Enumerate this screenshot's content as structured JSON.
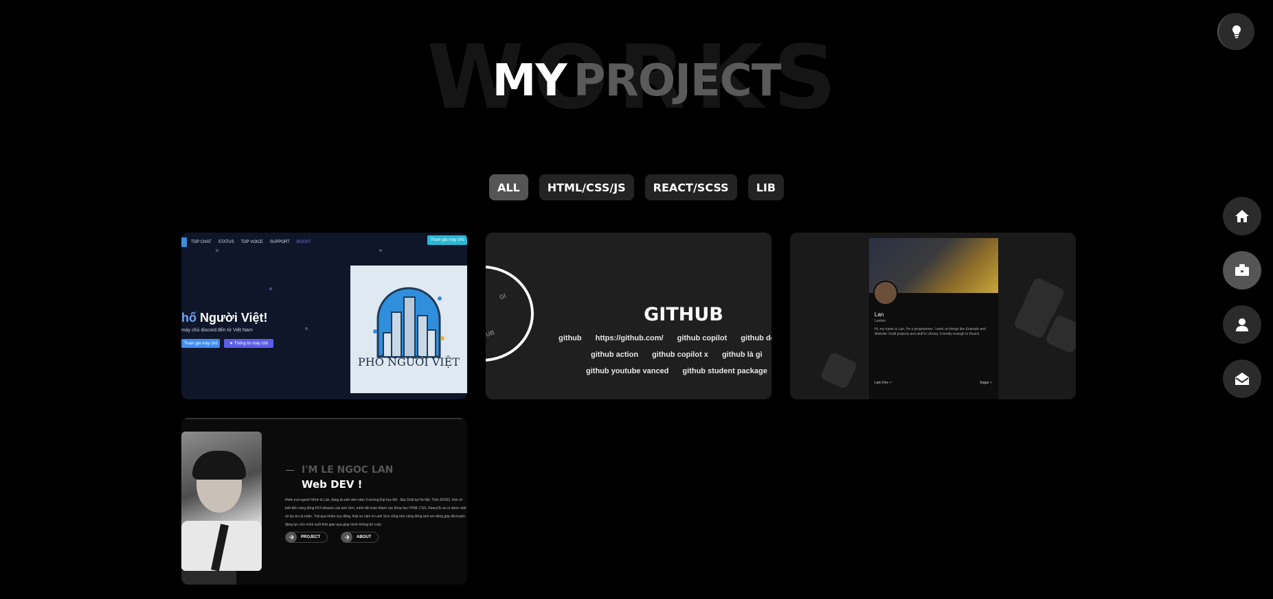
{
  "header": {
    "background_word": "WORKS",
    "title_strong": "MY",
    "title_muted": "PROJECT"
  },
  "theme_toggle": {
    "icon": "lightbulb-icon"
  },
  "filters": [
    {
      "label": "ALL",
      "active": true
    },
    {
      "label": "HTML/CSS/JS",
      "active": false
    },
    {
      "label": "REACT/SCSS",
      "active": false
    },
    {
      "label": "LIB",
      "active": false
    }
  ],
  "side_nav": [
    {
      "icon": "home-icon",
      "active": false
    },
    {
      "icon": "briefcase-icon",
      "active": true
    },
    {
      "icon": "user-icon",
      "active": false
    },
    {
      "icon": "mail-open-icon",
      "active": false
    }
  ],
  "projects": {
    "card1": {
      "nav": [
        "TOP CHAT",
        "STATUS",
        "TOP VOICE",
        "SUPPORT",
        "BOOST"
      ],
      "join_button": "Tham gia máy chủ",
      "heading_a": "hố ",
      "heading_b": "Người Việt!",
      "subtitle": "máy chủ discord đến từ Việt Nam",
      "btn_join": "Tham gia máy chủ",
      "btn_info": "★ Thông tin máy chủ",
      "logo_text": "PHỐ NGƯỜI VIỆT"
    },
    "card2": {
      "title": "GITHUB",
      "row1": [
        "github",
        "https://github.com/",
        "github copilot",
        "github deskt"
      ],
      "row2": [
        "github action",
        "github copilot x",
        "github là gì"
      ],
      "row3": [
        "github youtube vanced",
        "github student package"
      ],
      "arc_texts": [
        "GI",
        "UB"
      ]
    },
    "card3": {
      "profile_name": "Lan",
      "profile_handle": "Lanlele",
      "bio_text": "Hi, my name is Lan, I'm a programmer. I work on things like Example and Website I built projects and stuff in Library. Friendly enough to Reach.",
      "list_left": "Lam Dev ✓",
      "list_right": "Sugar ✓"
    },
    "card4": {
      "kicker": "I'M LE NGOC LAN",
      "role": "Web DEV !",
      "bio": "Hello mọi người! Mình là Lân, đang là sinh viên năm 3 trường Đại học Mỏ - Địa Chất tại Hà Nội. Thời 3/2022, tình cờ biết đến cộng đồng F8 Fullstack của anh Sơn, mình đã hoàn thành các khóa học HTML CSS, ReactJS và có được một số dự án cá nhân. Trải qua nhiều suy động, thật sự cảm ơn anh Sơn cũng như cộng đồng anh em đóng góp đã truyền động lực cho mình suốt thời gian qua giúp mình không bỏ cuộc.",
      "btn_project": "PROJECT",
      "btn_about": "ABOUT"
    }
  }
}
